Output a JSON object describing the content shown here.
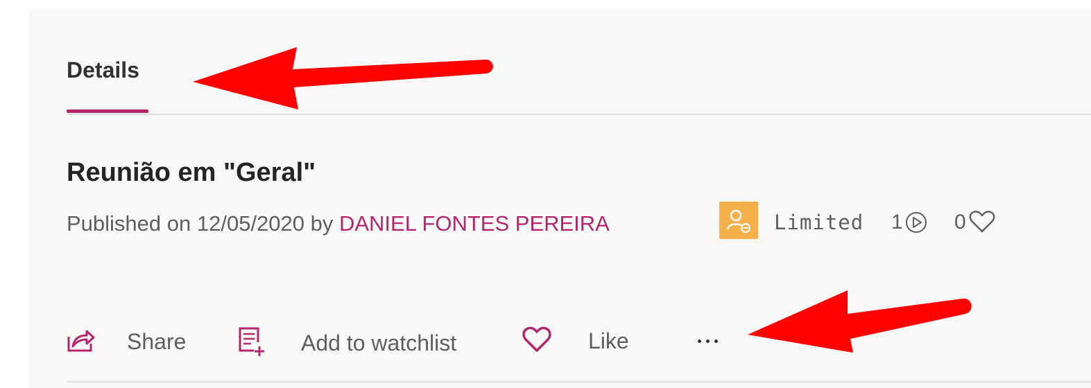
{
  "tabs": [
    {
      "label": "Details",
      "selected": true
    }
  ],
  "video": {
    "title": "Reunião em \"Geral\"",
    "published_prefix": "Published on 12/05/2020 by ",
    "author": "DANIEL FONTES PEREIRA",
    "visibility": "Limited",
    "views": "1",
    "likes": "0"
  },
  "actions": {
    "share_label": "Share",
    "watchlist_label": "Add to watchlist",
    "like_label": "Like",
    "more_icon": "ellipsis-icon"
  },
  "icons": {
    "share": "share-icon",
    "watchlist": "add-to-watchlist-icon",
    "like": "heart-icon",
    "views": "play-circle-icon",
    "likes": "heart-outline-icon",
    "visibility": "people-limited-icon"
  },
  "colors": {
    "accent": "#b4266c",
    "badge": "#f6b04b",
    "annotation_arrow": "#ff0000"
  }
}
